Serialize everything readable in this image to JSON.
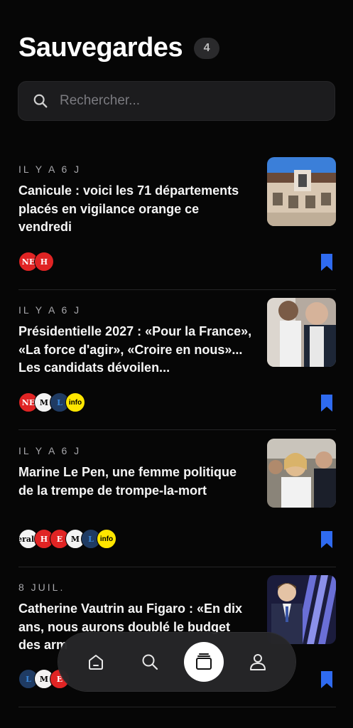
{
  "header": {
    "title": "Sauvegardes",
    "count": "4"
  },
  "search": {
    "placeholder": "Rechercher..."
  },
  "articles": [
    {
      "time": "IL Y A 6 J",
      "title": "Canicule : voici les 71 départements placés en vigilance orange ce vendredi",
      "sources": [
        "NE",
        "H"
      ]
    },
    {
      "time": "IL Y A 6 J",
      "title": "Présidentielle 2027 : «Pour la France», «La force d'agir», «Croire en nous»... Les candidats dévoilen...",
      "sources": [
        "NE",
        "M",
        "L",
        "info"
      ]
    },
    {
      "time": "IL Y A 6 J",
      "title": "Marine Le Pen, une femme politique de la trempe de trompe-la-mort",
      "sources": [
        "erald",
        "H",
        "E",
        "M",
        "L",
        "info"
      ]
    },
    {
      "time": "8 JUIL.",
      "title": "Catherine Vautrin au Figaro : «En dix ans, nous aurons doublé le budget des arm",
      "sources": [
        "L",
        "M",
        "E"
      ]
    }
  ],
  "nav": [
    "home-icon",
    "search-icon",
    "cards-icon",
    "profile-icon"
  ],
  "colors": {
    "accent": "#2f6bf0",
    "background": "#060606"
  }
}
